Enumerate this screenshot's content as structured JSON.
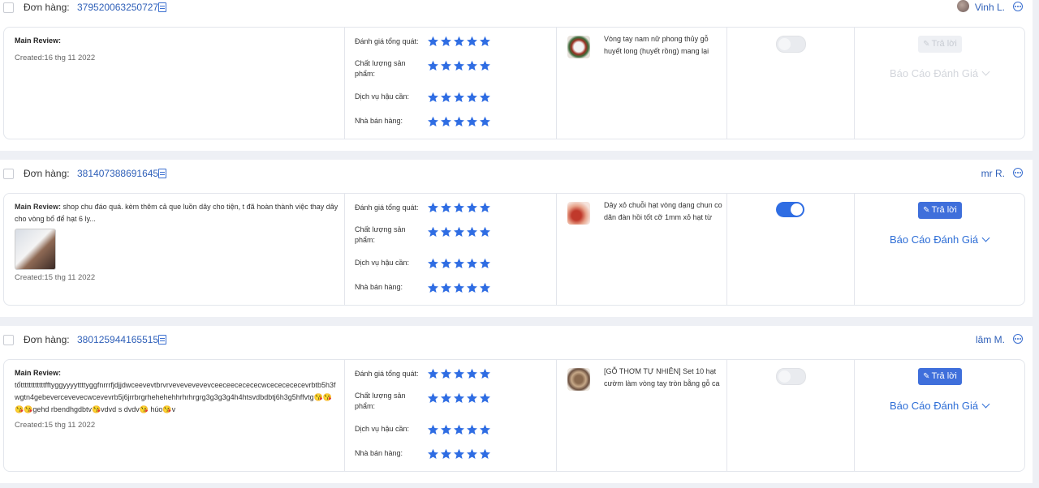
{
  "order_label": "Đơn hàng:",
  "reply_label": "Trả lời",
  "report_label": "Báo Cáo Đánh Giá",
  "rating_labels": [
    "Đánh giá tổng quát:",
    "Chất lượng sản phẩm:",
    "Dịch vụ hậu cần:",
    "Nhà bán hàng:"
  ],
  "colors": {
    "star": "#2f6de3",
    "link": "#2e5fb8",
    "toggle_on": "#2f6de3"
  },
  "reviews": [
    {
      "order_id": "379520063250727",
      "user": "Vinh L.",
      "title": "Main Review:",
      "text": "",
      "created": "Created:16 thg 11 2022",
      "ratings": [
        5,
        5,
        5,
        5
      ],
      "product_name": "Vòng tay nam nữ phong thủy gỗ huyết long (huyết rồng) mang lại may",
      "toggle_on": false,
      "reply_enabled": false
    },
    {
      "order_id": "381407388691645",
      "user": "mr R.",
      "title": "Main Review:",
      "text": "shop chu đáo quá. kèm thêm cả que luồn dây cho tiện, t đã hoàn thành việc thay dây cho vòng bổ để hạt 6 ly...",
      "created": "Created:15 thg 11 2022",
      "ratings": [
        5,
        5,
        5,
        5
      ],
      "product_name": "Dây xỏ chuỗi hạt vòng dạng chun co dãn đàn hồi tốt cỡ 1mm xỏ hạt từ",
      "toggle_on": true,
      "reply_enabled": true
    },
    {
      "order_id": "380125944165515",
      "user": "lâm M.",
      "title": "Main Review:",
      "text": "tốttttttttttttfftyggyyyyttttyggfnrrrfjdjjdwceevevtbrvrvevevevevevceeceececececwcececececevrbtb5h3fwgtn4gebevercevevecwcevevrb5j6jrrbrgrhehehehhrhrhrgrg3g3g3g4h4htsvdbdbtj6h3g5hffvtg😘😘😘😘gehd rbendhgdbtv😘vdvd s dvdv😘 húo😘v",
      "created": "Created:15 thg 11 2022",
      "ratings": [
        5,
        5,
        5,
        5
      ],
      "product_name": "[GỖ THƠM TỰ NHIÊN] Set 10 hạt cườm làm vòng tay tròn bằng gỗ ca",
      "toggle_on": false,
      "reply_enabled": true
    }
  ]
}
